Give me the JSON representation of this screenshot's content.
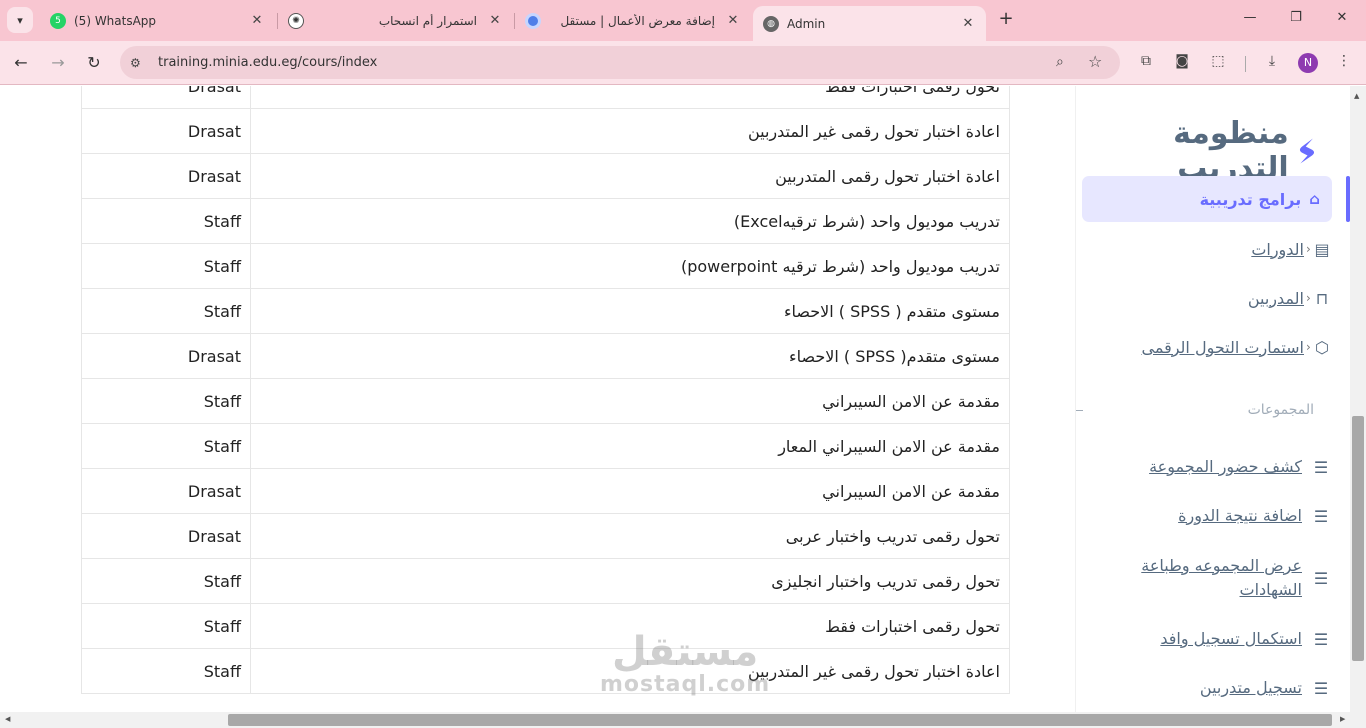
{
  "browser": {
    "tabs": [
      {
        "title": "(5) WhatsApp",
        "badge": "5",
        "icon": "whatsapp-icon",
        "active": false
      },
      {
        "title": "استمرار أم انسحاب",
        "icon": "chatgpt-icon",
        "active": false
      },
      {
        "title": "إضافة معرض الأعمال | مستقل",
        "icon": "mostaql-icon",
        "active": false
      },
      {
        "title": "Admin",
        "icon": "globe-icon",
        "active": true
      }
    ],
    "url": "training.minia.edu.eg/cours/index",
    "profile_initial": "N"
  },
  "colors": {
    "tabbar_bg": "#f8c6d1",
    "toolbar_bg": "#fbe3e9",
    "accent": "#696cff",
    "accent_bg": "#e7e7ff",
    "sidebar_text": "#566a7f"
  },
  "sidebar": {
    "brand_name": "منظومة التدريب",
    "active_item": {
      "label": "برامج تدريبية",
      "icon": "home-icon"
    },
    "menu_items": [
      {
        "label": "الدورات",
        "icon": "layout-icon"
      },
      {
        "label": "المدربين",
        "icon": "lock-open-icon"
      },
      {
        "label": "استمارت التحول الرقمى",
        "icon": "cube-icon"
      }
    ],
    "section_header": "المجموعات",
    "sub_items": [
      {
        "label": "كشف حضور المجموعة",
        "icon": "layers-icon"
      },
      {
        "label": "اضافة نتيجة الدورة",
        "icon": "layers-icon"
      },
      {
        "label": "عرض المجموعه وطباعة الشهادات",
        "icon": "layers-icon"
      },
      {
        "label": "استكمال تسجيل وافد",
        "icon": "layers-icon"
      },
      {
        "label": "تسجيل متدربين",
        "icon": "layers-icon"
      }
    ]
  },
  "table": {
    "rows": [
      {
        "name": "تحول رقمى اختبارات فقط",
        "type": "Drasat"
      },
      {
        "name": "اعادة اختبار تحول رقمى غير المتدربين",
        "type": "Drasat"
      },
      {
        "name": "اعادة اختبار تحول رقمى المتدربين",
        "type": "Drasat"
      },
      {
        "name": "تدريب موديول واحد (شرط ترقيهExcel)",
        "type": "Staff"
      },
      {
        "name": "تدريب موديول واحد (شرط ترقيه powerpoint)",
        "type": "Staff"
      },
      {
        "name": "مستوى متقدم ( SPSS ) الاحصاء",
        "type": "Staff"
      },
      {
        "name": "مستوى متقدم( SPSS ) الاحصاء",
        "type": "Drasat"
      },
      {
        "name": "مقدمة عن الامن السيبراني",
        "type": "Staff"
      },
      {
        "name": "مقدمة عن الامن السيبراني المعار",
        "type": "Staff"
      },
      {
        "name": "مقدمة عن الامن السيبراني",
        "type": "Drasat"
      },
      {
        "name": "تحول رقمى تدريب واختبار عربى",
        "type": "Drasat"
      },
      {
        "name": "تحول رقمى تدريب واختبار انجليزى",
        "type": "Staff"
      },
      {
        "name": "تحول رقمى اختبارات فقط",
        "type": "Staff"
      },
      {
        "name": "اعادة اختبار تحول رقمى غير المتدربين",
        "type": "Staff"
      }
    ]
  },
  "watermark": {
    "arabic": "مستقل",
    "latin": "mostaql.com"
  }
}
